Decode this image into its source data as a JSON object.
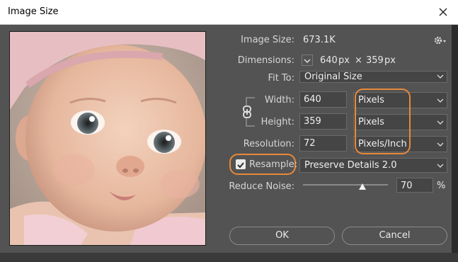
{
  "window": {
    "title": "Image Size"
  },
  "image_size": {
    "label": "Image Size:",
    "value": "673.1K"
  },
  "dimensions": {
    "label": "Dimensions:",
    "width": "640",
    "unit1": "px",
    "times": "×",
    "height": "359",
    "unit2": "px"
  },
  "fit_to": {
    "label": "Fit To:",
    "value": "Original Size"
  },
  "width": {
    "label": "Width:",
    "value": "640",
    "unit": "Pixels"
  },
  "height": {
    "label": "Height:",
    "value": "359",
    "unit": "Pixels"
  },
  "resolution": {
    "label": "Resolution:",
    "value": "72",
    "unit": "Pixels/Inch"
  },
  "resample": {
    "label": "Resample:",
    "checked": true,
    "method": "Preserve Details 2.0"
  },
  "reduce_noise": {
    "label": "Reduce Noise:",
    "value": "70",
    "unit": "%",
    "level": 0.7
  },
  "buttons": {
    "ok": "OK",
    "cancel": "Cancel"
  },
  "colors": {
    "highlight": "#e8893a",
    "dialog_bg": "#535353"
  }
}
